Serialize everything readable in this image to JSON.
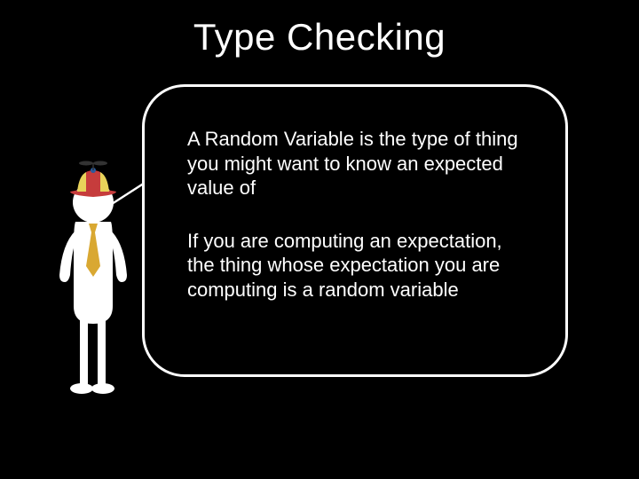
{
  "title": "Type Checking",
  "bubble": {
    "para1": "A Random Variable is the type of thing you might want to know an expected value of",
    "para2": "If you are computing an expectation, the thing whose expectation you are computing is a random variable"
  },
  "colors": {
    "background": "#000000",
    "text": "#ffffff",
    "tie": "#d9a832",
    "hat_red": "#c63c3c",
    "hat_yellow": "#e8d25a"
  }
}
